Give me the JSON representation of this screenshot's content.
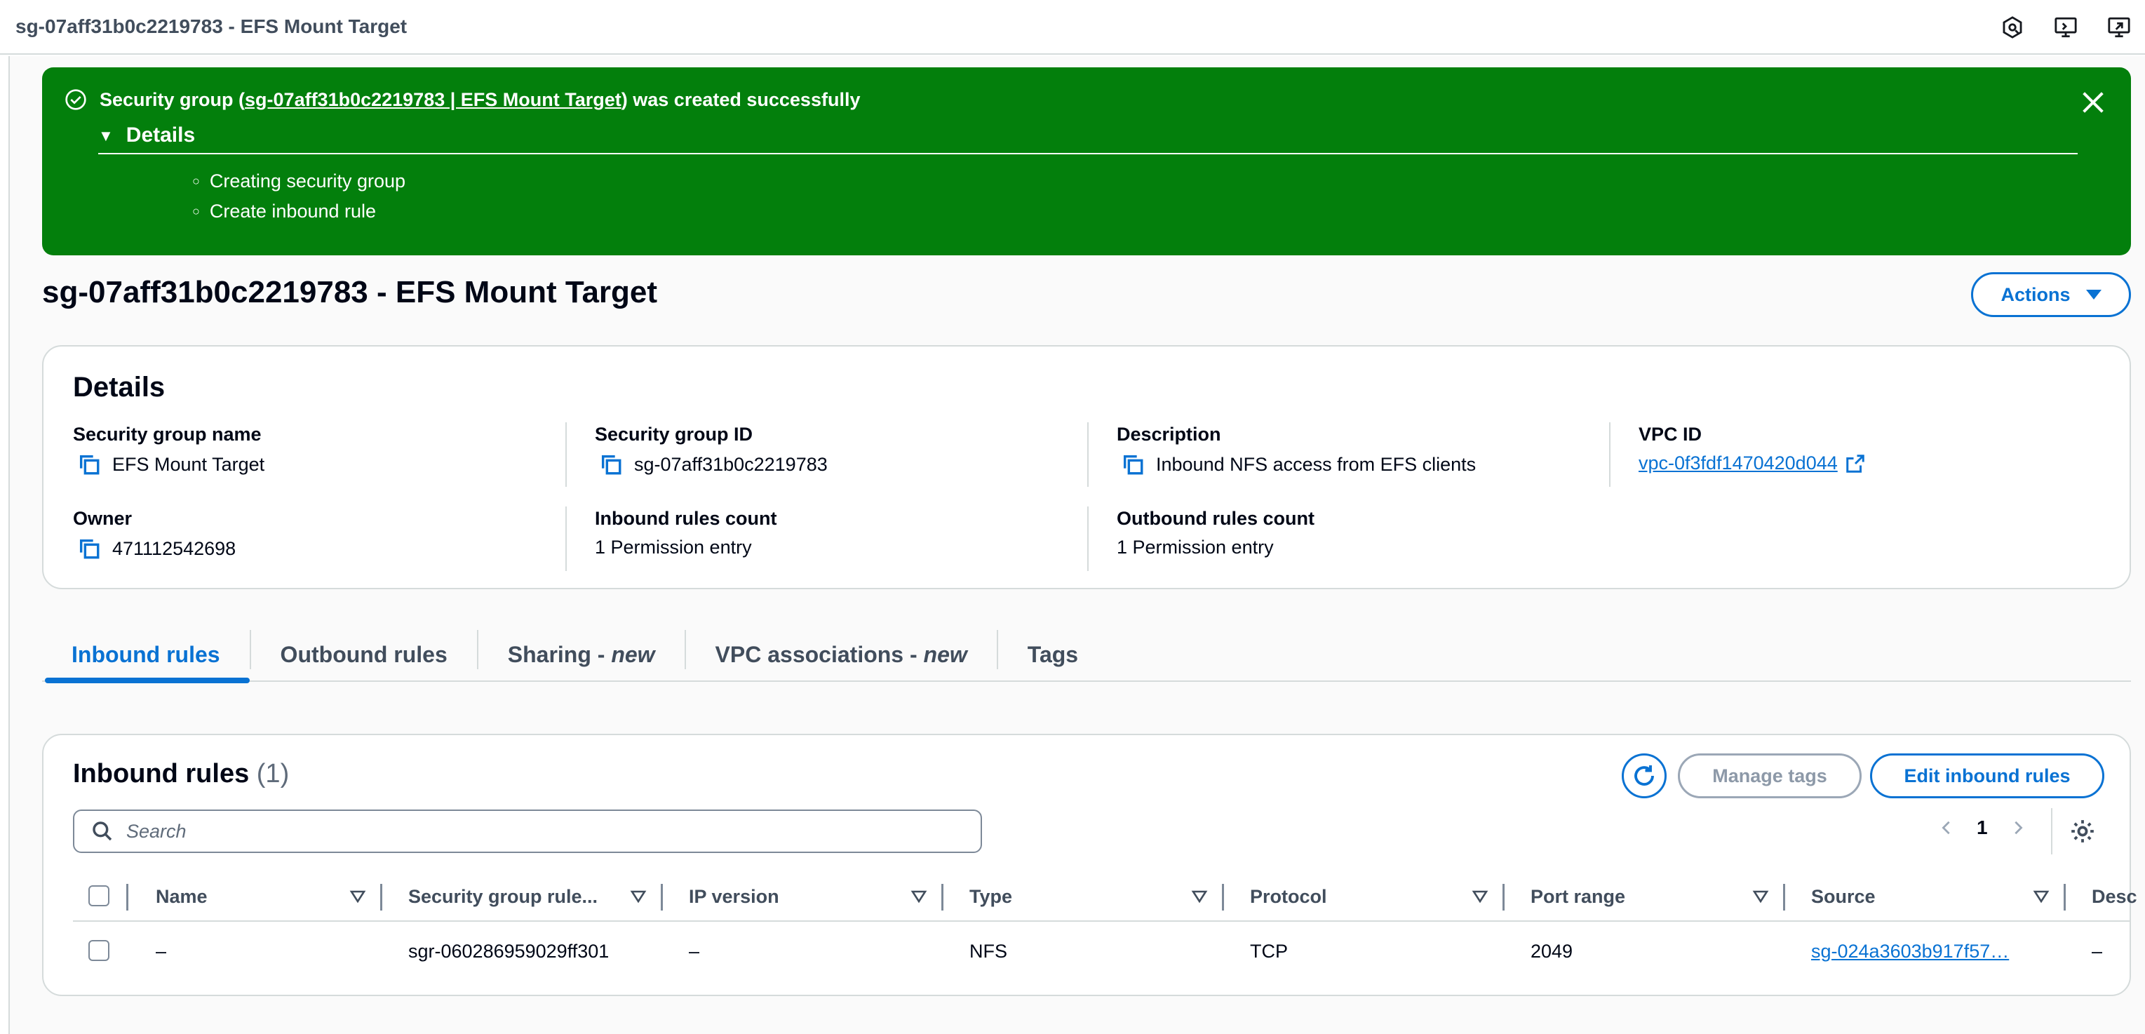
{
  "window": {
    "title": "sg-07aff31b0c2219783 - EFS Mount Target"
  },
  "flash": {
    "prefix": "Security group (",
    "link": "sg-07aff31b0c2219783 | EFS Mount Target",
    "suffix": ") was created successfully",
    "details_label": "Details",
    "items": [
      "Creating security group",
      "Create inbound rule"
    ]
  },
  "page": {
    "title": "sg-07aff31b0c2219783 - EFS Mount Target",
    "actions_label": "Actions"
  },
  "details": {
    "heading": "Details",
    "sg_name_label": "Security group name",
    "sg_name": "EFS Mount Target",
    "sg_id_label": "Security group ID",
    "sg_id": "sg-07aff31b0c2219783",
    "description_label": "Description",
    "description": "Inbound NFS access from EFS clients",
    "vpc_label": "VPC ID",
    "vpc_id": "vpc-0f3fdf1470420d044",
    "owner_label": "Owner",
    "owner": "471112542698",
    "inbound_count_label": "Inbound rules count",
    "inbound_count": "1 Permission entry",
    "outbound_count_label": "Outbound rules count",
    "outbound_count": "1 Permission entry"
  },
  "tabs": [
    {
      "label": "Inbound rules",
      "suffix": ""
    },
    {
      "label": "Outbound rules",
      "suffix": ""
    },
    {
      "label": "Sharing - ",
      "suffix": "new"
    },
    {
      "label": "VPC associations - ",
      "suffix": "new"
    },
    {
      "label": "Tags",
      "suffix": ""
    }
  ],
  "rules": {
    "title": "Inbound rules",
    "count": "(1)",
    "manage_tags": "Manage tags",
    "edit": "Edit inbound rules",
    "search_placeholder": "Search",
    "page": "1",
    "columns": [
      "Name",
      "Security group rule...",
      "IP version",
      "Type",
      "Protocol",
      "Port range",
      "Source",
      "Desc"
    ],
    "rows": [
      [
        "–",
        "sgr-060286959029ff301",
        "–",
        "NFS",
        "TCP",
        "2049",
        "sg-024a3603b917f57…",
        "–"
      ]
    ]
  }
}
